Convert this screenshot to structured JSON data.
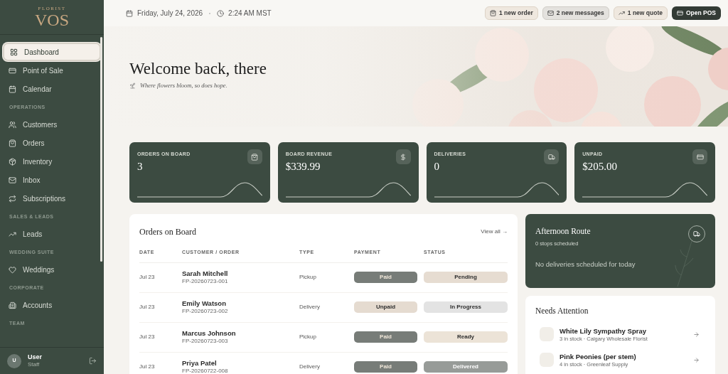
{
  "logo": {
    "tagline": "FLORIST",
    "name": "VOS"
  },
  "sidebar": {
    "sections": [
      {
        "items": [
          {
            "label": "Dashboard",
            "selected": true
          },
          {
            "label": "Point of Sale",
            "selected": false
          },
          {
            "label": "Calendar",
            "selected": false
          }
        ]
      },
      {
        "heading": "OPERATIONS",
        "items": [
          {
            "label": "Customers",
            "selected": false
          },
          {
            "label": "Orders",
            "selected": false
          },
          {
            "label": "Inventory",
            "selected": false
          },
          {
            "label": "Inbox",
            "selected": false
          },
          {
            "label": "Subscriptions",
            "selected": false
          }
        ]
      },
      {
        "heading": "SALES & LEADS",
        "items": [
          {
            "label": "Leads",
            "selected": false
          }
        ]
      },
      {
        "heading": "WEDDING SUITE",
        "items": [
          {
            "label": "Weddings",
            "selected": false
          }
        ]
      },
      {
        "heading": "CORPORATE",
        "items": [
          {
            "label": "Accounts",
            "selected": false
          }
        ]
      },
      {
        "heading": "TEAM"
      }
    ],
    "user": {
      "initial": "U",
      "name": "User",
      "role": "Staff"
    }
  },
  "topbar": {
    "date": "Friday, July 24, 2026",
    "time": "2:24 AM MST",
    "notices": [
      {
        "kind": "order",
        "label": "1 new order"
      },
      {
        "kind": "message",
        "label": "2 new messages"
      },
      {
        "kind": "quote",
        "label": "1 new quote"
      }
    ],
    "primary_button": "Open POS"
  },
  "hero": {
    "title": "Welcome back, there",
    "subtitle": "Where flowers bloom, so does hope."
  },
  "stats": [
    {
      "label": "ORDERS ON BOARD",
      "value": "3"
    },
    {
      "label": "BOARD REVENUE",
      "value": "$339.99"
    },
    {
      "label": "DELIVERIES",
      "value": "0"
    },
    {
      "label": "UNPAID",
      "value": "$205.00"
    }
  ],
  "orders": {
    "title": "Orders on Board",
    "view_all": "View all →",
    "columns": [
      "DATE",
      "CUSTOMER / ORDER",
      "TYPE",
      "PAYMENT",
      "STATUS"
    ],
    "rows": [
      {
        "date": "Jul 23",
        "customer": "Sarah Mitchell",
        "order": "FP-20260723-001",
        "type": "Pickup",
        "payment": {
          "kind": "paid",
          "label": "Paid"
        },
        "status": {
          "kind": "pending",
          "label": "Pending"
        }
      },
      {
        "date": "Jul 23",
        "customer": "Emily Watson",
        "order": "FP-20260723-002",
        "type": "Delivery",
        "payment": {
          "kind": "unpaid",
          "label": "Unpaid"
        },
        "status": {
          "kind": "in_progress",
          "label": "In Progress"
        }
      },
      {
        "date": "Jul 23",
        "customer": "Marcus Johnson",
        "order": "FP-20260723-003",
        "type": "Pickup",
        "payment": {
          "kind": "paid",
          "label": "Paid"
        },
        "status": {
          "kind": "ready",
          "label": "Ready"
        }
      },
      {
        "date": "Jul 23",
        "customer": "Priya Patel",
        "order": "FP-20260722-008",
        "type": "Delivery",
        "payment": {
          "kind": "paid",
          "label": "Paid"
        },
        "status": {
          "kind": "delivered",
          "label": "Delivered"
        }
      }
    ]
  },
  "route": {
    "title": "Afternoon Route",
    "stops": "0 stops scheduled",
    "empty": "No deliveries scheduled for today"
  },
  "attention": {
    "title": "Needs Attention",
    "items": [
      {
        "name": "White Lily Sympathy Spray",
        "detail": "3 in stock · Calgary Wholesale Florist"
      },
      {
        "name": "Pink Peonies (per stem)",
        "detail": "4 in stock · Greenleaf Supply"
      }
    ]
  }
}
